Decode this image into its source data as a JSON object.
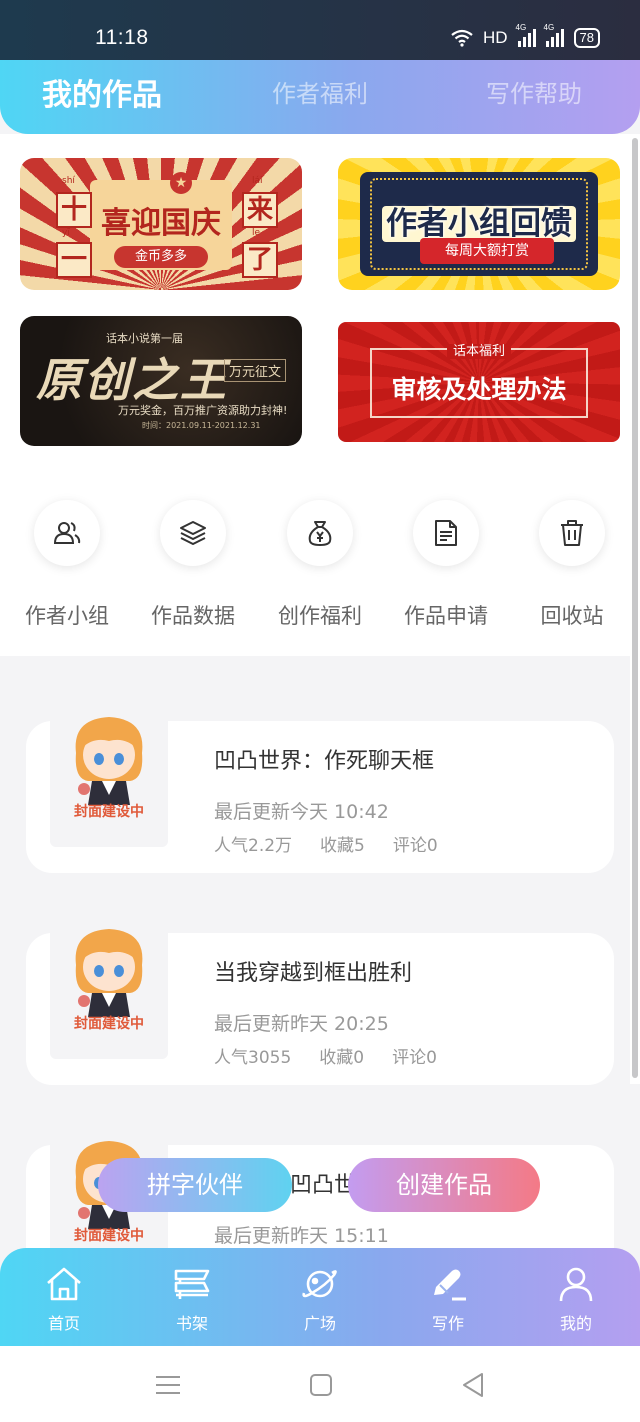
{
  "status": {
    "time": "11:18",
    "network": "HD",
    "signal1": "4G",
    "signal2": "4G",
    "battery": "78"
  },
  "top_tabs": [
    {
      "label": "我的作品",
      "active": true
    },
    {
      "label": "作者福利",
      "active": false
    },
    {
      "label": "写作帮助",
      "active": false
    }
  ],
  "banners": {
    "national_day": {
      "title": "喜迎国庆",
      "subtitle": "金币多多",
      "left_top": "十",
      "left_bottom": "一",
      "right_top": "来",
      "right_bottom": "了",
      "py1": "shí",
      "py2": "yī",
      "py3": "lái",
      "py4": "le"
    },
    "author_group": {
      "title": "作者小组回馈",
      "subtitle": "每周大额打赏"
    },
    "original_king": {
      "kicker": "话本小说第一届",
      "title": "原创之王",
      "tag": "万元征文",
      "desc": "万元奖金，百万推广资源助力封神!",
      "time": "时间：2021.09.11-2021.12.31"
    },
    "review": {
      "kicker": "话本福利",
      "title": "审核及处理办法"
    }
  },
  "quick_actions": [
    {
      "label": "作者小组",
      "icon": "author-group-icon"
    },
    {
      "label": "作品数据",
      "icon": "layers-icon"
    },
    {
      "label": "创作福利",
      "icon": "money-bag-icon"
    },
    {
      "label": "作品申请",
      "icon": "document-icon"
    },
    {
      "label": "回收站",
      "icon": "trash-icon"
    }
  ],
  "works": [
    {
      "title": "凹凸世界：作死聊天框",
      "updated": "最后更新今天 10:42",
      "popularity": "人气2.2万",
      "favorites": "收藏5",
      "comments": "评论0",
      "cover_text": "封面建设中"
    },
    {
      "title": "当我穿越到框出胜利",
      "updated": "最后更新昨天 20:25",
      "popularity": "人气3055",
      "favorites": "收藏0",
      "comments": "评论0",
      "cover_text": "封面建设中"
    },
    {
      "title": "凹凸世界",
      "updated": "最后更新昨天 15:11",
      "cover_text": "封面建设中"
    }
  ],
  "actions": {
    "partner": "拼字伙伴",
    "create": "创建作品"
  },
  "bottom_nav": [
    {
      "label": "首页",
      "icon": "home-icon"
    },
    {
      "label": "书架",
      "icon": "bookshelf-icon"
    },
    {
      "label": "广场",
      "icon": "planet-icon"
    },
    {
      "label": "写作",
      "icon": "pen-icon",
      "active": true
    },
    {
      "label": "我的",
      "icon": "user-icon"
    }
  ],
  "colors": {
    "header_start": "#4fd6f4",
    "header_end": "#b49ff0",
    "accent_red": "#f47a86"
  }
}
